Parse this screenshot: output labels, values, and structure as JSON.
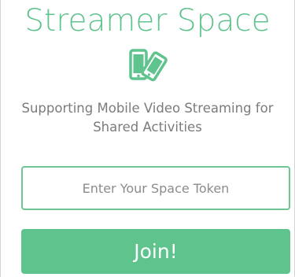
{
  "app": {
    "title": "Streamer Space",
    "subtitle": "Supporting Mobile Video Streaming for Shared Activities",
    "logo_icon": "phones-sharing-icon",
    "accent_color": "#5ec38d"
  },
  "form": {
    "token_placeholder": "Enter Your Space Token",
    "token_value": "",
    "join_label": "Join!"
  }
}
